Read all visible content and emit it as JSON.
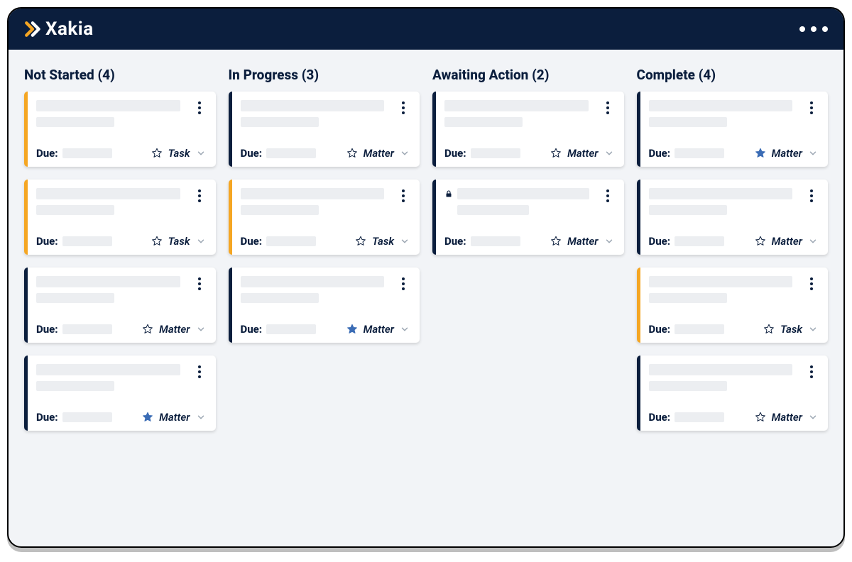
{
  "brand": {
    "name": "Xakia",
    "accent": "#f5a623"
  },
  "due_label": "Due:",
  "columns": [
    {
      "title": "Not Started (4)",
      "cards": [
        {
          "stripe": "#f5a623",
          "type": "Task",
          "starred": false,
          "locked": false
        },
        {
          "stripe": "#f5a623",
          "type": "Task",
          "starred": false,
          "locked": false
        },
        {
          "stripe": "#0b1e3d",
          "type": "Matter",
          "starred": false,
          "locked": false
        },
        {
          "stripe": "#0b1e3d",
          "type": "Matter",
          "starred": true,
          "locked": false
        }
      ]
    },
    {
      "title": "In Progress (3)",
      "cards": [
        {
          "stripe": "#0b1e3d",
          "type": "Matter",
          "starred": false,
          "locked": false
        },
        {
          "stripe": "#f5a623",
          "type": "Task",
          "starred": false,
          "locked": false
        },
        {
          "stripe": "#0b1e3d",
          "type": "Matter",
          "starred": true,
          "locked": false
        }
      ]
    },
    {
      "title": "Awaiting Action (2)",
      "cards": [
        {
          "stripe": "#0b1e3d",
          "type": "Matter",
          "starred": false,
          "locked": false
        },
        {
          "stripe": "#0b1e3d",
          "type": "Matter",
          "starred": false,
          "locked": true
        }
      ]
    },
    {
      "title": "Complete (4)",
      "cards": [
        {
          "stripe": "#0b1e3d",
          "type": "Matter",
          "starred": true,
          "locked": false
        },
        {
          "stripe": "#0b1e3d",
          "type": "Matter",
          "starred": false,
          "locked": false
        },
        {
          "stripe": "#f5a623",
          "type": "Task",
          "starred": false,
          "locked": false
        },
        {
          "stripe": "#0b1e3d",
          "type": "Matter",
          "starred": false,
          "locked": false
        }
      ]
    }
  ]
}
